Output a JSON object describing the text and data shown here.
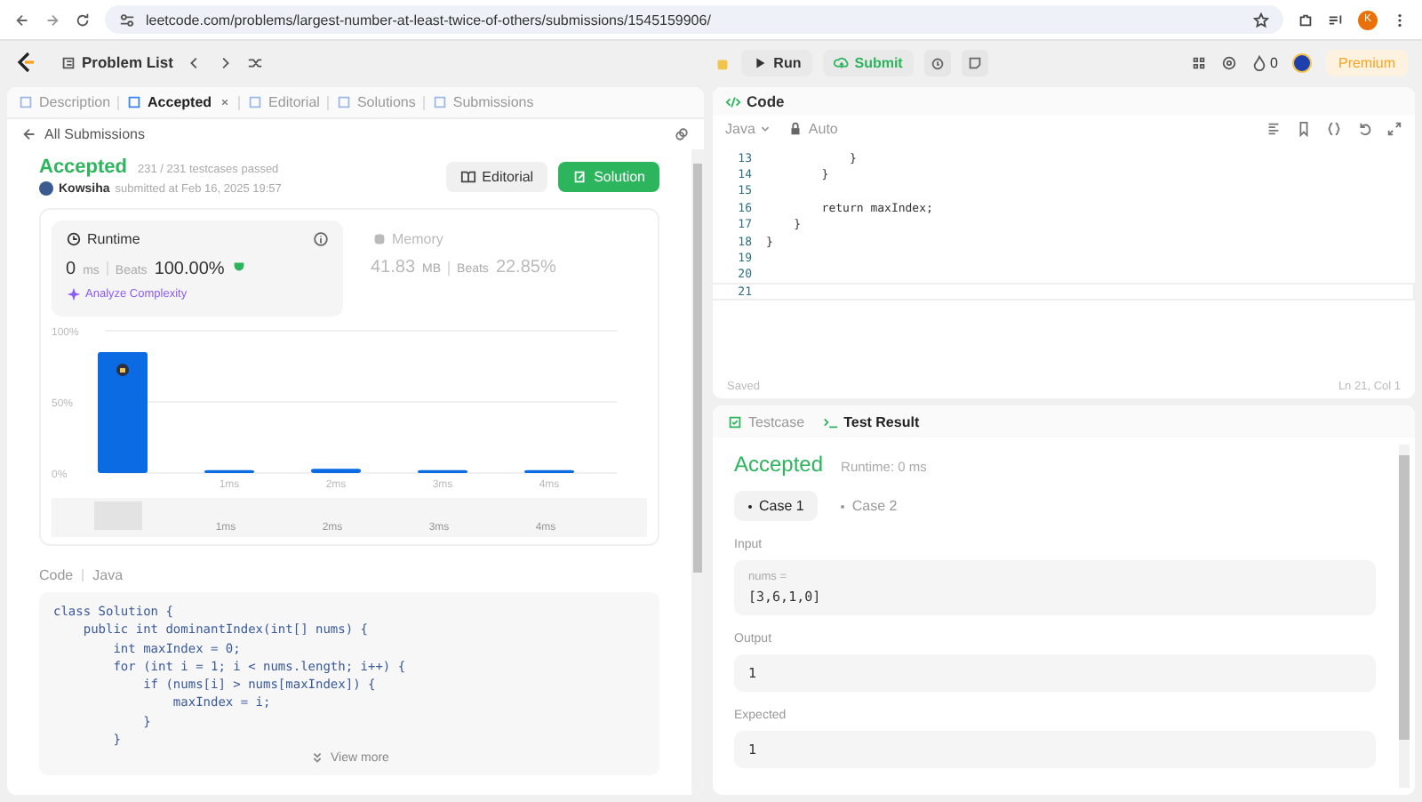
{
  "browser": {
    "url": "leetcode.com/problems/largest-number-at-least-twice-of-others/submissions/1545159906/",
    "profile_initial": "K"
  },
  "toolbar": {
    "problem_list": "Problem List",
    "run": "Run",
    "submit": "Submit",
    "streak": "0",
    "premium": "Premium"
  },
  "left_tabs": [
    {
      "label": "Description",
      "selected": false,
      "closable": false
    },
    {
      "label": "Accepted",
      "selected": true,
      "closable": true
    },
    {
      "label": "Editorial",
      "selected": false,
      "closable": false
    },
    {
      "label": "Solutions",
      "selected": false,
      "closable": false
    },
    {
      "label": "Submissions",
      "selected": false,
      "closable": false
    }
  ],
  "back_link": "All Submissions",
  "submission": {
    "status": "Accepted",
    "testcases": "231 / 231 testcases passed",
    "user": "Kowsiha",
    "submitted": "submitted at Feb 16, 2025 19:57",
    "editorial_button": "Editorial",
    "solution_button": "Solution"
  },
  "stats": [
    {
      "title": "Runtime",
      "value": "0",
      "unit": "ms",
      "beats_label": "Beats",
      "beats": "100.00%",
      "analyze": "Analyze Complexity",
      "selected": true
    },
    {
      "title": "Memory",
      "value": "41.83",
      "unit": "MB",
      "beats_label": "Beats",
      "beats": "22.85%",
      "selected": false
    }
  ],
  "chart_data": {
    "type": "bar",
    "categories": [
      null,
      "1ms",
      "2ms",
      "3ms",
      "4ms"
    ],
    "values": [
      85,
      2,
      3,
      2,
      2
    ],
    "ylim": [
      0,
      100
    ],
    "yticks": [
      {
        "value": 0,
        "label": "0%"
      },
      {
        "value": 50,
        "label": "50%"
      },
      {
        "value": 100,
        "label": "100%"
      }
    ]
  },
  "minimap_labels": [
    "1ms",
    "2ms",
    "3ms",
    "4ms"
  ],
  "code_section": {
    "label": "Code",
    "language": "Java",
    "view_more": "View more",
    "lines": [
      "class Solution {",
      "    public int dominantIndex(int[] nums) {",
      "        int maxIndex = 0;",
      "        for (int i = 1; i < nums.length; i++) {",
      "            if (nums[i] > nums[maxIndex]) {",
      "                maxIndex = i;",
      "            }",
      "        }"
    ]
  },
  "editor": {
    "title": "Code",
    "language": "Java",
    "mode": "Auto",
    "status": "Saved",
    "position": "Ln 21, Col 1",
    "lines": [
      {
        "number": "13",
        "text": "            }",
        "current": false
      },
      {
        "number": "14",
        "text": "        }",
        "current": false
      },
      {
        "number": "15",
        "current": false
      },
      {
        "number": "16",
        "text": "        return maxIndex;",
        "current": false
      },
      {
        "number": "17",
        "text": "    }",
        "current": false
      },
      {
        "number": "18",
        "text": "}",
        "current": false
      },
      {
        "number": "19",
        "current": false
      },
      {
        "number": "20",
        "current": false
      },
      {
        "number": "21",
        "current": true
      }
    ]
  },
  "result_tabs": [
    {
      "label": "Testcase",
      "selected": false
    },
    {
      "label": "Test Result",
      "selected": true
    }
  ],
  "result": {
    "status": "Accepted",
    "runtime": "Runtime: 0 ms",
    "cases": [
      {
        "label": "Case 1",
        "selected": true
      },
      {
        "label": "Case 2",
        "selected": false
      }
    ],
    "sections": [
      {
        "label": "Input",
        "param": "nums =",
        "value": "[3,6,1,0]"
      },
      {
        "label": "Output",
        "value": "1"
      },
      {
        "label": "Expected",
        "value": "1"
      }
    ]
  }
}
